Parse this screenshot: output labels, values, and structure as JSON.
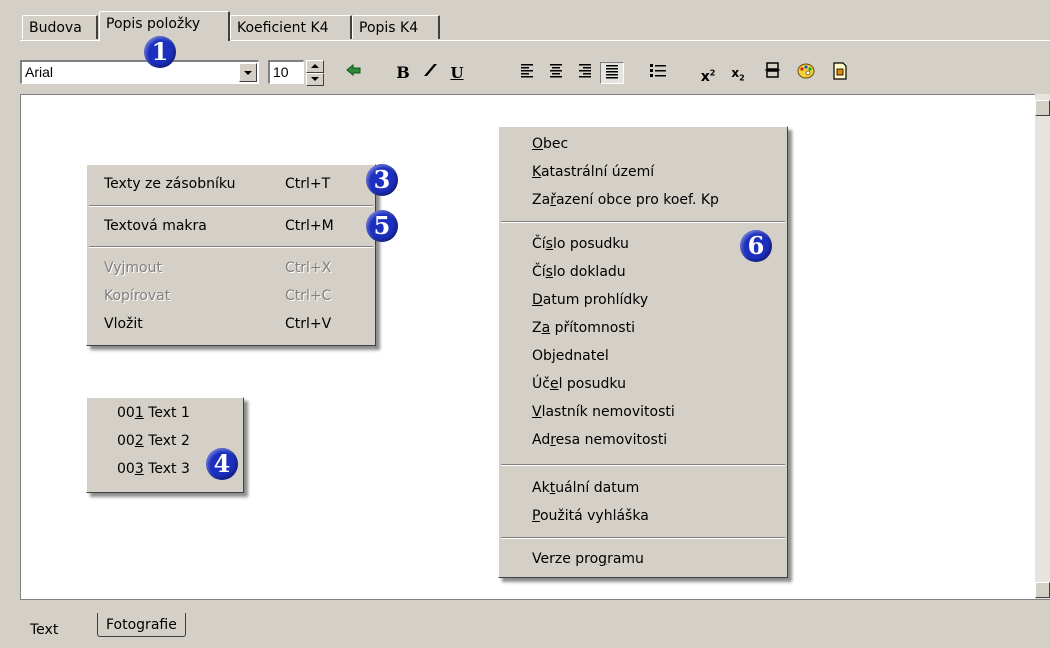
{
  "tabs": [
    {
      "label": "Budova"
    },
    {
      "label": "Popis položky"
    },
    {
      "label": "Koeficient K4"
    },
    {
      "label": "Popis K4"
    }
  ],
  "toolbar": {
    "font_name": "Arial",
    "font_size": "10",
    "icons": [
      "undo-icon",
      "bold-icon",
      "italic-icon",
      "underline-icon",
      "align-left-icon",
      "align-center-icon",
      "align-right-icon",
      "align-justify-icon",
      "bullet-list-icon",
      "superscript-icon",
      "subscript-icon",
      "page-break-icon",
      "palette-icon",
      "insert-icon"
    ]
  },
  "context_menu": {
    "items": [
      {
        "pre": "Texty ze zásobníku",
        "shortcut": "Ctrl+T",
        "disabled": false
      },
      {
        "pre": "Textová makra",
        "shortcut": "Ctrl+M",
        "disabled": false
      },
      {
        "pre": "Vyjmout",
        "shortcut": "Ctrl+X",
        "disabled": true
      },
      {
        "pre": "Kopírovat",
        "shortcut": "Ctrl+C",
        "disabled": true
      },
      {
        "pre": "Vložit",
        "shortcut": "Ctrl+V",
        "disabled": false
      }
    ]
  },
  "text_menu": {
    "items": [
      {
        "pre": "00",
        "ul": "1",
        "post": " Text 1"
      },
      {
        "pre": "00",
        "ul": "2",
        "post": " Text 2"
      },
      {
        "pre": "00",
        "ul": "3",
        "post": " Text 3"
      }
    ]
  },
  "macro_menu": {
    "groups": [
      [
        {
          "pre": "",
          "ul": "O",
          "post": "bec"
        },
        {
          "pre": "",
          "ul": "K",
          "post": "atastrální území"
        },
        {
          "pre": "Za",
          "ul": "ř",
          "post": "azení obce pro koef. Kp"
        }
      ],
      [
        {
          "pre": "Čí",
          "ul": "s",
          "post": "lo posudku"
        },
        {
          "pre": "Čí",
          "ul": "s",
          "post": "lo dokladu"
        },
        {
          "pre": "",
          "ul": "D",
          "post": "atum prohlídky"
        },
        {
          "pre": "Z",
          "ul": "a",
          "post": " přítomnosti"
        },
        {
          "pre": "Ob",
          "ul": "j",
          "post": "ednatel"
        },
        {
          "pre": "Úč",
          "ul": "e",
          "post": "l posudku"
        },
        {
          "pre": "",
          "ul": "V",
          "post": "lastník nemovitosti"
        },
        {
          "pre": "Ad",
          "ul": "r",
          "post": "esa nemovitosti"
        }
      ],
      [
        {
          "pre": "Ak",
          "ul": "t",
          "post": "uální datum"
        },
        {
          "pre": "",
          "ul": "P",
          "post": "oužitá vyhláška"
        }
      ],
      [
        {
          "pre": "Verze pro",
          "ul": "g",
          "post": "ramu"
        }
      ]
    ]
  },
  "bottom_tabs": [
    {
      "label": "Text"
    },
    {
      "label": "Fotografie"
    }
  ],
  "callouts": [
    "1",
    "3",
    "4",
    "5",
    "6"
  ]
}
